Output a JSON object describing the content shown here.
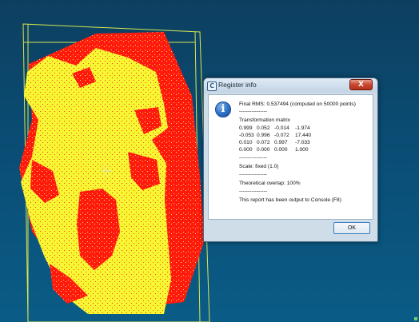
{
  "viewport": {
    "background_top": "#0d3f60",
    "background_bottom": "#0a5c86",
    "cloud_colors": {
      "reference": "#ff1a10",
      "aligned": "#f6f632"
    },
    "bbox_color": "#d7e650"
  },
  "dialog": {
    "title": "Register info",
    "close_label": "X",
    "icon_name": "info-icon",
    "lines": {
      "final_rms": "Final RMS: 0.537494 (computed on 50000 points)",
      "sep1": "----------------",
      "matrix_title": "Transformation matrix",
      "scale": "Scale: fixed (1.0)",
      "sep2": "----------------",
      "overlap": "Theoretical overlap: 100%",
      "sep3": "----------------",
      "report": "This report has been output to Console (F8)"
    },
    "matrix": [
      [
        "0.999",
        "0.052",
        "-0.014",
        "-1.974"
      ],
      [
        "-0.053",
        "0.996",
        "-0.072",
        "17.440"
      ],
      [
        "0.010",
        "0.072",
        "0.997",
        "-7.033"
      ],
      [
        "0.000",
        "0.000",
        "0.000",
        "1.000"
      ]
    ],
    "ok_label": "OK"
  }
}
